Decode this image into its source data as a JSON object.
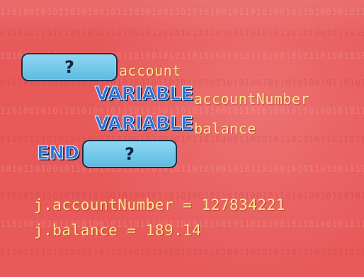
{
  "background": {
    "color": "#e85a5a",
    "binary_rows": [
      "1101001010110101001011101010011010101001011010100101101001010110100101",
      "0110101101010010101101001011010101101010011010101101010010110101010010",
      "1010110100101101010101101001010110101001010110100101011010010101101001",
      "0101010110101001011010100101101010010110101001011010100101101010010110"
    ]
  },
  "slide": {
    "placeholder_1": "?",
    "line1_name": "account",
    "keyword_variable_1": "VARIABLE",
    "line2_name": "accountNumber",
    "keyword_variable_2": "VARIABLE",
    "line3_name": "balance",
    "keyword_end": "END",
    "placeholder_2": "?",
    "assignment_1": "j.accountNumber = 127834221",
    "assignment_2": "j.balance = 189.14"
  },
  "colors": {
    "keyword_blue": "#2e6fd8",
    "placeholder_box": "#6cc8ea",
    "code_yellow": "#ffe88a"
  }
}
